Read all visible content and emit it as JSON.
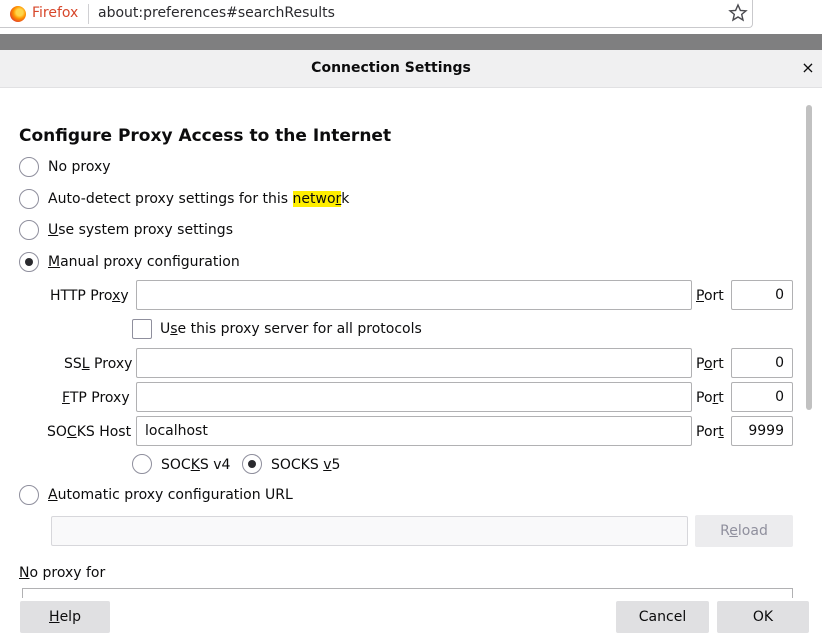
{
  "browser": {
    "name": "Firefox",
    "url": "about:preferences#searchResults"
  },
  "dialog": {
    "title": "Connection Settings",
    "close_label": "×"
  },
  "proxy": {
    "section_title": "Configure Proxy Access to the Internet",
    "options": {
      "no_proxy": "No proxy",
      "auto_detect_pre": "Auto-detect proxy settings for this ",
      "auto_detect_hl": "netwo",
      "auto_detect_hl_ul": "r",
      "auto_detect_post": "k",
      "system_pre": "",
      "system_ul": "U",
      "system_post": "se system proxy settings",
      "manual_ul": "M",
      "manual_post": "anual proxy configuration",
      "auto_url_ul": "A",
      "auto_url_post": "utomatic proxy configuration URL"
    },
    "selected": "manual",
    "http": {
      "label_pre": "HTTP Pro",
      "label_ul": "x",
      "label_post": "y",
      "value": "",
      "port_label_pre": "",
      "port_label_ul": "P",
      "port_label_post": "ort",
      "port": "0"
    },
    "share": {
      "label_pre": "U",
      "label_ul": "s",
      "label_post": "e this proxy server for all protocols",
      "checked": false
    },
    "ssl": {
      "label_pre": "SS",
      "label_ul": "L",
      "label_post": " Proxy",
      "value": "",
      "port_label_pre": "P",
      "port_label_ul": "o",
      "port_label_post": "rt",
      "port": "0"
    },
    "ftp": {
      "label_pre": "",
      "label_ul": "F",
      "label_post": "TP Proxy",
      "value": "",
      "port_label_pre": "Po",
      "port_label_ul": "r",
      "port_label_post": "t",
      "port": "0"
    },
    "socks": {
      "label_pre": "SO",
      "label_ul": "C",
      "label_post": "KS Host",
      "value": "localhost",
      "port_label_pre": "Por",
      "port_label_ul": "t",
      "port_label_post": "",
      "port": "9999"
    },
    "socks_v4": {
      "pre": "SOC",
      "ul": "K",
      "post": "S v4"
    },
    "socks_v5": {
      "pre": "SOCKS ",
      "ul": "v",
      "post": "5"
    },
    "socks_version": "v5",
    "auto_url_value": "",
    "reload_pre": "R",
    "reload_ul": "e",
    "reload_post": "load",
    "no_proxy_for_ul": "N",
    "no_proxy_for_post": "o proxy for"
  },
  "footer": {
    "help_ul": "H",
    "help_post": "elp",
    "cancel": "Cancel",
    "ok": "OK"
  }
}
